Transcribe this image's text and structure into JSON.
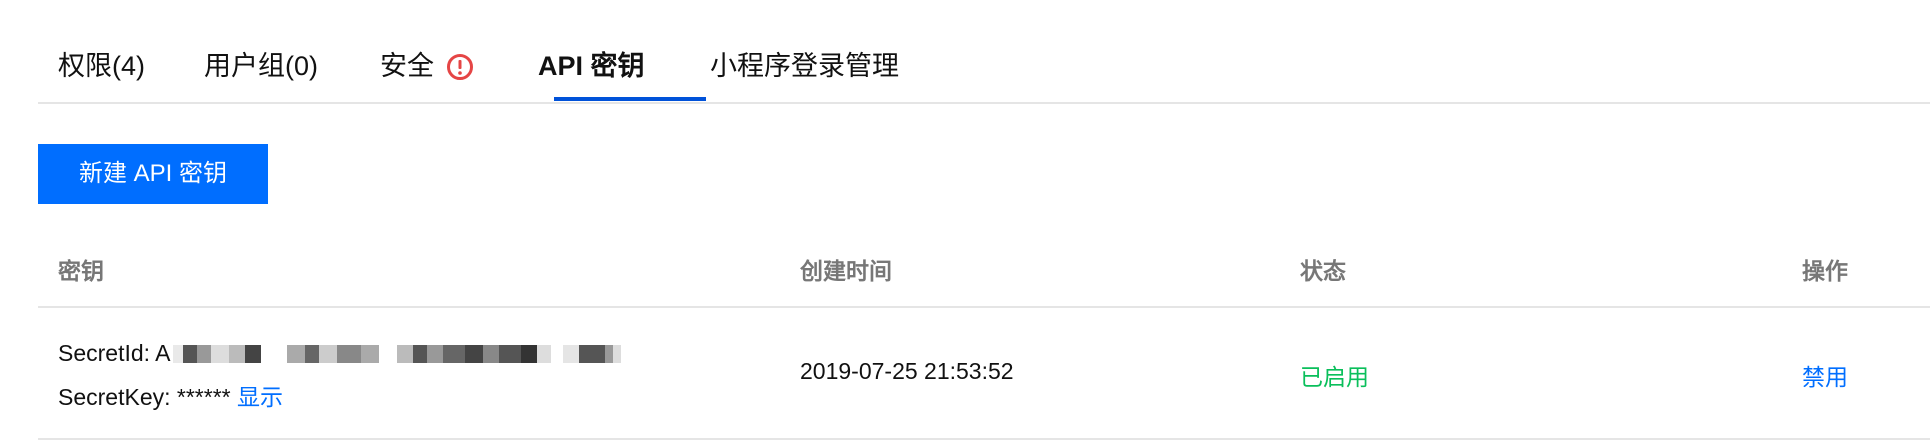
{
  "tabs": [
    {
      "label": "权限(4)"
    },
    {
      "label": "用户组(0)"
    },
    {
      "label": "安全"
    },
    {
      "label": "API 密钥"
    },
    {
      "label": "小程序登录管理"
    }
  ],
  "active_tab": "API 密钥",
  "actions": {
    "new_key_label": "新建 API 密钥"
  },
  "table": {
    "headers": {
      "key": "密钥",
      "created": "创建时间",
      "status": "状态",
      "operation": "操作"
    },
    "rows": [
      {
        "secret_id_label": "SecretId: A",
        "secret_key_label": "SecretKey: ******",
        "show_link": "显示",
        "created": "2019-07-25 21:53:52",
        "status": "已启用",
        "operation": "禁用"
      }
    ]
  },
  "colors": {
    "primary": "#006eff",
    "tab_underline": "#0052d9",
    "status_enabled": "#0abf5b",
    "warning": "#e54545"
  }
}
